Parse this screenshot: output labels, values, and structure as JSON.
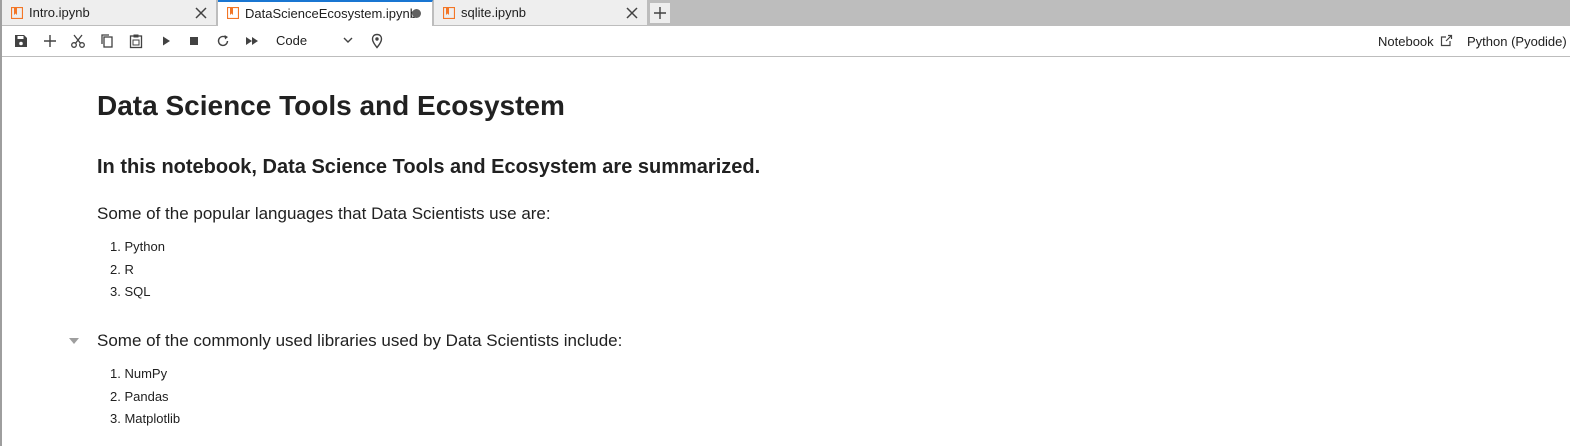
{
  "tabs": [
    {
      "label": "Intro.ipynb",
      "state": "normal"
    },
    {
      "label": "DataScienceEcosystem.ipynb",
      "state": "active-modified"
    },
    {
      "label": "sqlite.ipynb",
      "state": "normal"
    }
  ],
  "toolbar": {
    "icons": [
      "save-icon",
      "add-cell-icon",
      "cut-icon",
      "copy-icon",
      "paste-icon",
      "run-icon",
      "stop-icon",
      "restart-icon",
      "run-all-icon",
      "location-icon"
    ],
    "cell_type": "Code",
    "open_in": "Notebook",
    "kernel": "Python (Pyodide)"
  },
  "notebook": {
    "title": "Data Science Tools and Ecosystem",
    "intro": "In this notebook, Data Science Tools and Ecosystem are summarized.",
    "languages_heading": "Some of the popular languages that Data Scientists use are:",
    "languages": [
      "1. Python",
      "2. R",
      "3. SQL"
    ],
    "libraries_heading": "Some of the commonly used libraries used by Data Scientists include:",
    "libraries": [
      "1. NumPy",
      "2. Pandas",
      "3. Matplotlib"
    ]
  },
  "colors": {
    "tab_active_accent": "#1976d2",
    "notebook_icon": "#f37626",
    "tabbar_bg": "#bdbdbd"
  }
}
